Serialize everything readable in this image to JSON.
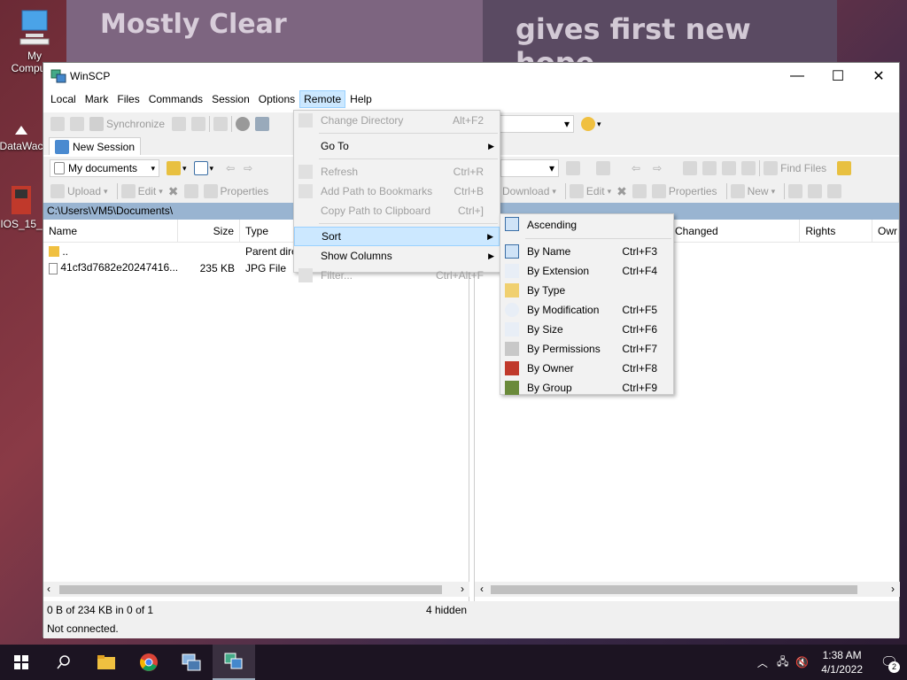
{
  "desktop": {
    "news_left": "Mostly Clear",
    "news_right": "gives first new hope",
    "icons": [
      {
        "label": "My Computer",
        "icon": "computer-icon"
      },
      {
        "label": "DataWac",
        "icon": "shortcut-icon"
      },
      {
        "label": "IOS_15_",
        "icon": "app-icon"
      }
    ]
  },
  "window": {
    "title": "WinSCP",
    "controls": {
      "minimize": "—",
      "maximize": "☐",
      "close": "✕"
    }
  },
  "menubar": [
    "Local",
    "Mark",
    "Files",
    "Commands",
    "Session",
    "Options",
    "Remote",
    "Help"
  ],
  "toolbar_top": {
    "synchronize": "Synchronize"
  },
  "session_tab": "New Session",
  "left_panel": {
    "location": "My documents",
    "actions": {
      "upload": "Upload",
      "edit": "Edit",
      "properties": "Properties"
    },
    "path": "C:\\Users\\VM5\\Documents\\",
    "columns": [
      "Name",
      "Size",
      "Type"
    ],
    "rows": [
      {
        "name": "..",
        "size": "",
        "type": "Parent dire"
      },
      {
        "name": "41cf3d7682e20247416...",
        "size": "235 KB",
        "type": "JPG File"
      }
    ],
    "status": "0 B of 234 KB in 0 of 1",
    "hidden": "4 hidden"
  },
  "right_panel": {
    "find_files": "Find Files",
    "actions": {
      "download": "Download",
      "edit": "Edit",
      "properties": "Properties",
      "new": "New"
    },
    "columns": [
      "Changed",
      "Rights",
      "Owr"
    ]
  },
  "status_bottom": "Not connected.",
  "remote_menu": [
    {
      "label": "Change Directory",
      "shortcut": "Alt+F2",
      "disabled": true
    },
    {
      "label": "Go To",
      "submenu": true
    },
    {
      "label": "Refresh",
      "shortcut": "Ctrl+R",
      "disabled": true
    },
    {
      "label": "Add Path to Bookmarks",
      "shortcut": "Ctrl+B",
      "disabled": true
    },
    {
      "label": "Copy Path to Clipboard",
      "shortcut": "Ctrl+]",
      "disabled": true
    },
    {
      "label": "Sort",
      "submenu": true,
      "highlight": true
    },
    {
      "label": "Show Columns",
      "submenu": true
    },
    {
      "label": "Filter...",
      "shortcut": "Ctrl+Alt+F",
      "disabled": true
    }
  ],
  "sort_menu": [
    {
      "label": "Ascending",
      "shortcut": ""
    },
    {
      "label": "By Name",
      "shortcut": "Ctrl+F3"
    },
    {
      "label": "By Extension",
      "shortcut": "Ctrl+F4"
    },
    {
      "label": "By Type",
      "shortcut": ""
    },
    {
      "label": "By Modification",
      "shortcut": "Ctrl+F5"
    },
    {
      "label": "By Size",
      "shortcut": "Ctrl+F6"
    },
    {
      "label": "By Permissions",
      "shortcut": "Ctrl+F7"
    },
    {
      "label": "By Owner",
      "shortcut": "Ctrl+F8"
    },
    {
      "label": "By Group",
      "shortcut": "Ctrl+F9"
    }
  ],
  "taskbar": {
    "time": "1:38 AM",
    "date": "4/1/2022",
    "notifications": "2"
  }
}
